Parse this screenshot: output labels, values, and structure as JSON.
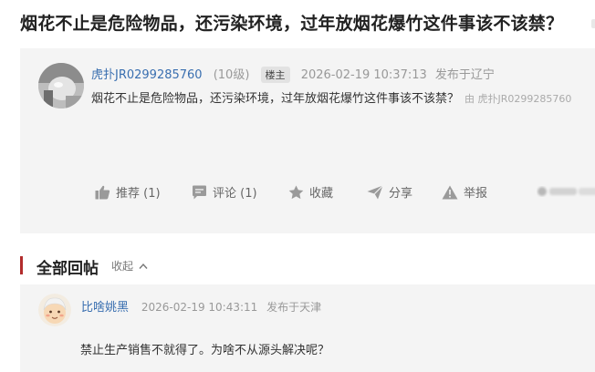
{
  "thread": {
    "title": "烟花不止是危险物品，还污染环境，过年放烟花爆竹这件事该不该禁？"
  },
  "post": {
    "username": "虎扑JR0299285760",
    "level": "(10级)",
    "badge": "楼主",
    "timestamp": "2026-02-19 10:37:13",
    "location": "发布于辽宁",
    "content": "烟花不止是危险物品，还污染环境，过年放烟花爆竹这件事该不该禁？",
    "source_note": "由 虎扑JR0299285760",
    "actions": {
      "recommend": "推荐 (1)",
      "comment": "评论 (1)",
      "favorite": "收藏",
      "share": "分享",
      "report": "举报"
    }
  },
  "replies_section": {
    "title": "全部回帖",
    "collapse_label": "收起"
  },
  "reply": {
    "username": "比啥姚黑",
    "timestamp": "2026-02-19 10:43:11",
    "location": "发布于天津",
    "content": "禁止生产销售不就得了。为啥不从源头解决呢？"
  },
  "colors": {
    "accent_red": "#b22c2c",
    "link_blue": "#3a6fb0",
    "card_bg": "#f4f4f4"
  }
}
